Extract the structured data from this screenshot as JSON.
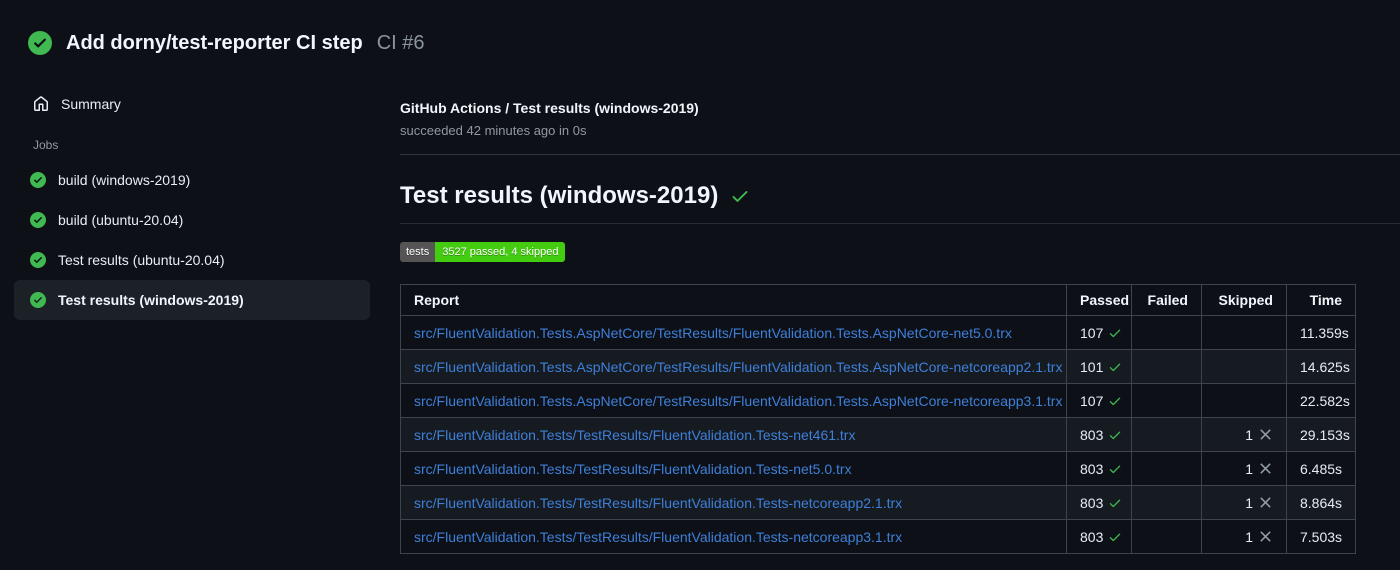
{
  "header": {
    "title": "Add dorny/test-reporter CI step",
    "run_number": "CI #6",
    "status": "success"
  },
  "sidebar": {
    "summary_label": "Summary",
    "jobs_label": "Jobs",
    "jobs": [
      {
        "label": "build (windows-2019)",
        "status": "success",
        "selected": false
      },
      {
        "label": "build (ubuntu-20.04)",
        "status": "success",
        "selected": false
      },
      {
        "label": "Test results (ubuntu-20.04)",
        "status": "success",
        "selected": false
      },
      {
        "label": "Test results (windows-2019)",
        "status": "success",
        "selected": true
      }
    ]
  },
  "main": {
    "breadcrumb": "GitHub Actions / Test results (windows-2019)",
    "status_line": "succeeded 42 minutes ago in 0s",
    "section_title": "Test results (windows-2019)",
    "section_status_icon": "check-icon",
    "badge": {
      "label": "tests",
      "value": "3527 passed, 4 skipped",
      "label_bg": "#555555",
      "value_bg": "#44cc11"
    },
    "table": {
      "columns": [
        "Report",
        "Passed",
        "Failed",
        "Skipped",
        "Time"
      ],
      "rows": [
        {
          "report": "src/FluentValidation.Tests.AspNetCore/TestResults/FluentValidation.Tests.AspNetCore-net5.0.trx",
          "passed": "107",
          "failed": "",
          "skipped": "",
          "time": "11.359s"
        },
        {
          "report": "src/FluentValidation.Tests.AspNetCore/TestResults/FluentValidation.Tests.AspNetCore-netcoreapp2.1.trx",
          "passed": "101",
          "failed": "",
          "skipped": "",
          "time": "14.625s"
        },
        {
          "report": "src/FluentValidation.Tests.AspNetCore/TestResults/FluentValidation.Tests.AspNetCore-netcoreapp3.1.trx",
          "passed": "107",
          "failed": "",
          "skipped": "",
          "time": "22.582s"
        },
        {
          "report": "src/FluentValidation.Tests/TestResults/FluentValidation.Tests-net461.trx",
          "passed": "803",
          "failed": "",
          "skipped": "1",
          "time": "29.153s"
        },
        {
          "report": "src/FluentValidation.Tests/TestResults/FluentValidation.Tests-net5.0.trx",
          "passed": "803",
          "failed": "",
          "skipped": "1",
          "time": "6.485s"
        },
        {
          "report": "src/FluentValidation.Tests/TestResults/FluentValidation.Tests-netcoreapp2.1.trx",
          "passed": "803",
          "failed": "",
          "skipped": "1",
          "time": "8.864s"
        },
        {
          "report": "src/FluentValidation.Tests/TestResults/FluentValidation.Tests-netcoreapp3.1.trx",
          "passed": "803",
          "failed": "",
          "skipped": "1",
          "time": "7.503s"
        }
      ]
    }
  },
  "colors": {
    "page_bg": "#0d1117",
    "success_green": "#3fb950",
    "link_blue": "#3f7fd9",
    "muted_text": "#9198a1",
    "table_border": "#3d444d",
    "row_alt_bg": "#161b22",
    "selected_item_bg": "#1c2128",
    "badge_label_bg": "#555555",
    "badge_value_bg": "#44cc11"
  }
}
